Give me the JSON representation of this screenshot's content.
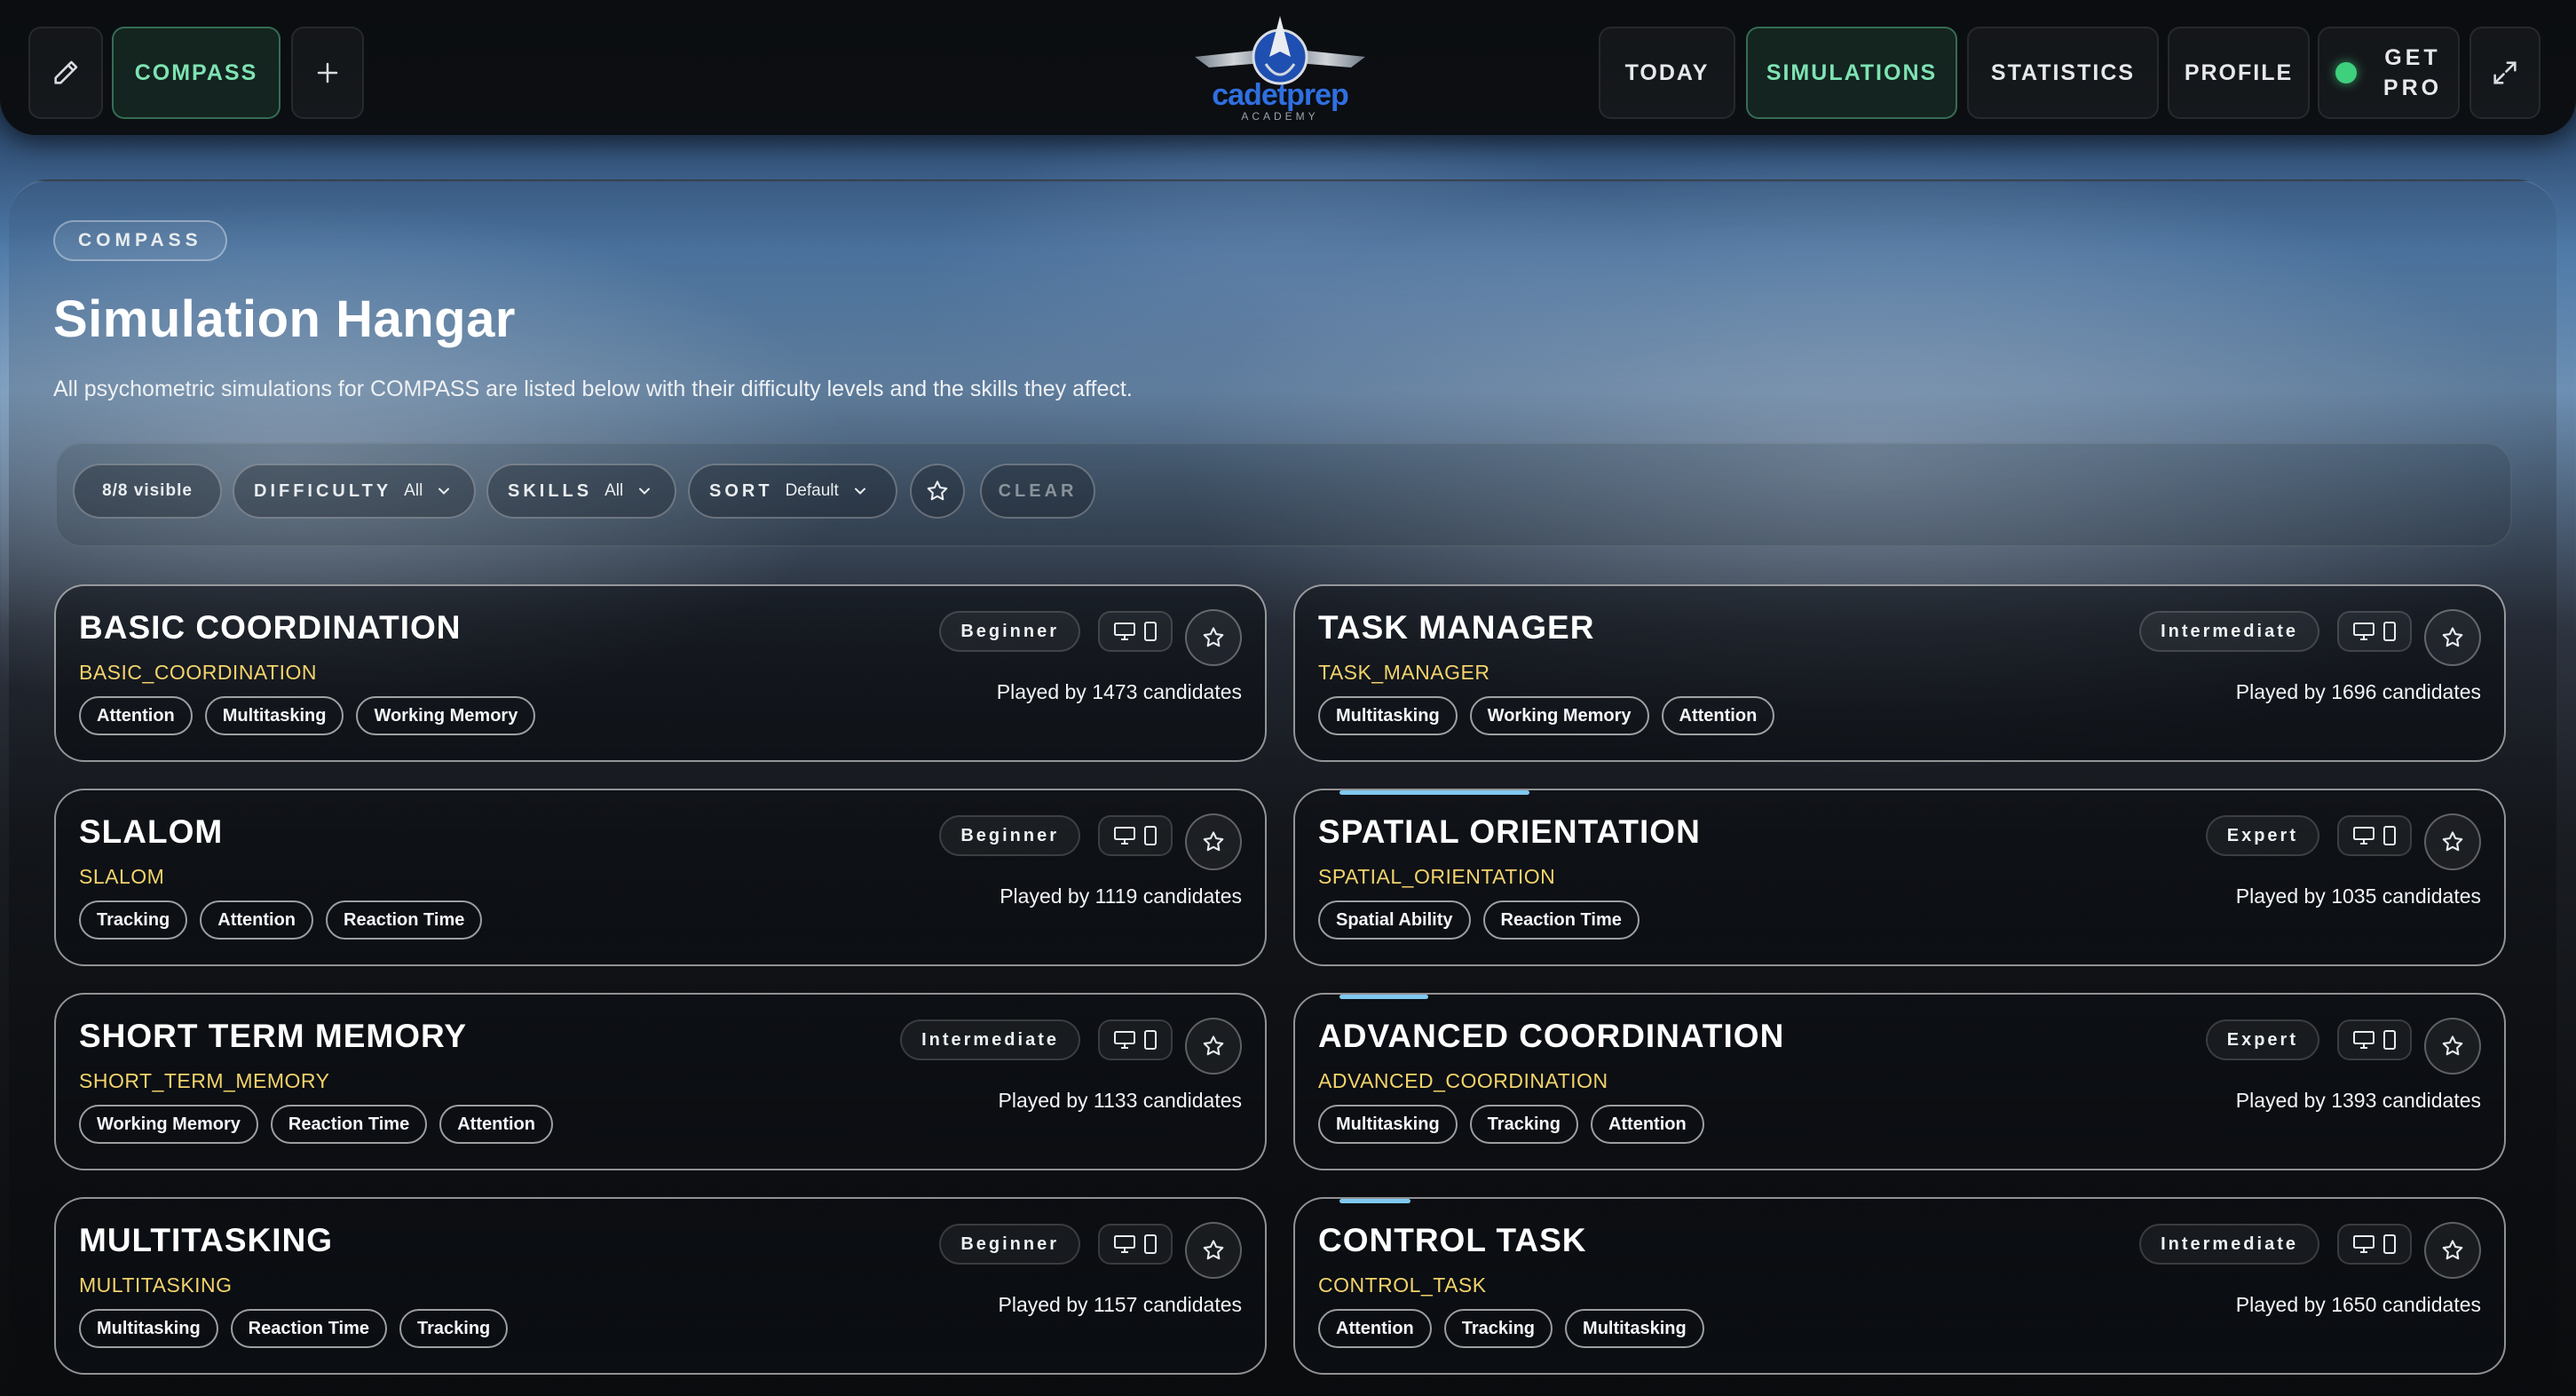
{
  "topbar": {
    "compass_label": "COMPASS",
    "logo_text": "cadetprep",
    "logo_sub": "ACADEMY",
    "nav": [
      "TODAY",
      "SIMULATIONS",
      "STATISTICS",
      "PROFILE"
    ],
    "active_nav": "SIMULATIONS",
    "get_pro_line1": "GET",
    "get_pro_line2": "PRO"
  },
  "page": {
    "badge": "COMPASS",
    "title": "Simulation Hangar",
    "subtitle": "All psychometric simulations for COMPASS are listed below with their difficulty levels and the skills they affect."
  },
  "filters": {
    "visible": "8/8 visible",
    "difficulty_key": "DIFFICULTY",
    "difficulty_val": "All",
    "skills_key": "SKILLS",
    "skills_val": "All",
    "sort_key": "SORT",
    "sort_val": "Default",
    "clear": "CLEAR"
  },
  "cards": [
    {
      "title": "BASIC COORDINATION",
      "code": "BASIC_COORDINATION",
      "level": "Beginner",
      "tags": [
        "Attention",
        "Multitasking",
        "Working Memory"
      ],
      "played": "Played by 1473 candidates"
    },
    {
      "title": "TASK MANAGER",
      "code": "TASK_MANAGER",
      "level": "Intermediate",
      "tags": [
        "Multitasking",
        "Working Memory",
        "Attention"
      ],
      "played": "Played by 1696 candidates"
    },
    {
      "title": "SLALOM",
      "code": "SLALOM",
      "level": "Beginner",
      "tags": [
        "Tracking",
        "Attention",
        "Reaction Time"
      ],
      "played": "Played by 1119 candidates"
    },
    {
      "title": "SPATIAL ORIENTATION",
      "code": "SPATIAL_ORIENTATION",
      "level": "Expert",
      "tags": [
        "Spatial Ability",
        "Reaction Time"
      ],
      "played": "Played by 1035 candidates"
    },
    {
      "title": "SHORT TERM MEMORY",
      "code": "SHORT_TERM_MEMORY",
      "level": "Intermediate",
      "tags": [
        "Working Memory",
        "Reaction Time",
        "Attention"
      ],
      "played": "Played by 1133 candidates"
    },
    {
      "title": "ADVANCED COORDINATION",
      "code": "ADVANCED_COORDINATION",
      "level": "Expert",
      "tags": [
        "Multitasking",
        "Tracking",
        "Attention"
      ],
      "played": "Played by 1393 candidates"
    },
    {
      "title": "MULTITASKING",
      "code": "MULTITASKING",
      "level": "Beginner",
      "tags": [
        "Multitasking",
        "Reaction Time",
        "Tracking"
      ],
      "played": "Played by 1157 candidates"
    },
    {
      "title": "CONTROL TASK",
      "code": "CONTROL_TASK",
      "level": "Intermediate",
      "tags": [
        "Attention",
        "Tracking",
        "Multitasking"
      ],
      "played": "Played by 1650 candidates"
    }
  ]
}
